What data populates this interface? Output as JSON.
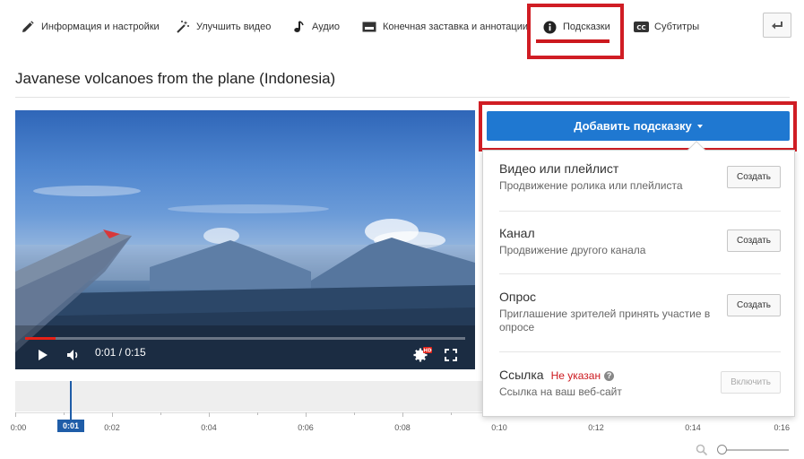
{
  "nav": {
    "tabs": [
      {
        "label": "Информация и настройки",
        "icon": "pencil-icon"
      },
      {
        "label": "Улучшить видео",
        "icon": "magic-wand-icon"
      },
      {
        "label": "Аудио",
        "icon": "music-note-icon"
      },
      {
        "label": "Конечная заставка и аннотации",
        "icon": "endscreen-icon"
      },
      {
        "label": "Подсказки",
        "icon": "info-icon",
        "active": true
      },
      {
        "label": "Субтитры",
        "icon": "cc-icon"
      }
    ],
    "back_icon": "back-arrow-icon"
  },
  "video": {
    "title": "Javanese volcanoes from the plane (Indonesia)",
    "time_display": "0:01 / 0:15",
    "progress": 0.07
  },
  "timeline": {
    "labels": [
      "0:00",
      "0:02",
      "0:04",
      "0:06",
      "0:08",
      "0:10",
      "0:12",
      "0:14",
      "0:16"
    ],
    "playhead_label": "0:01"
  },
  "cards": {
    "add_button_label": "Добавить подсказку",
    "items": [
      {
        "name": "Видео или плейлист",
        "desc": "Продвижение ролика или плейлиста",
        "button": "Создать"
      },
      {
        "name": "Канал",
        "desc": "Продвижение другого канала",
        "button": "Создать"
      },
      {
        "name": "Опрос",
        "desc": "Приглашение зрителей принять участие в опросе",
        "button": "Создать"
      },
      {
        "name": "Ссылка",
        "warning": "Не указан",
        "desc": "Ссылка на ваш веб-сайт",
        "button": "Включить",
        "disabled": true
      }
    ]
  },
  "colors": {
    "accent_blue": "#1f78d1",
    "highlight_red": "#d01d24",
    "progress_red": "#e62117"
  }
}
